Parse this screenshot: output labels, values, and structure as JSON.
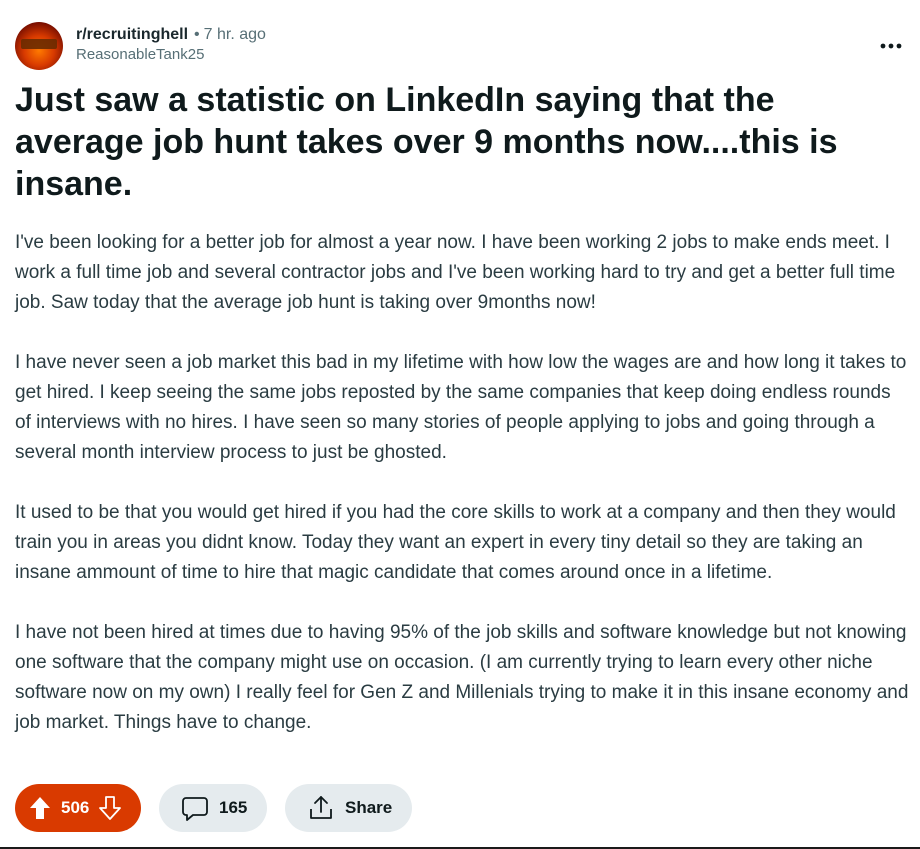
{
  "post": {
    "subreddit": "r/recruitinghell",
    "separator": "•",
    "time": "7 hr. ago",
    "author": "ReasonableTank25",
    "more_label": "•••",
    "title": "Just saw a statistic on LinkedIn saying that the average job hunt takes over 9 months now....this is insane.",
    "paragraphs": [
      "I've been looking for a better job for almost a year now. I have been working 2 jobs to make ends meet. I work a full time job and several contractor jobs and I've been working hard to try and get a better full time job. Saw today that the average job hunt is taking over 9months now!",
      "I have never seen a job market this bad in my lifetime with how low the wages are and how long it takes to get hired. I keep seeing the same jobs reposted by the same companies that keep doing endless rounds of interviews with no hires. I have seen so many stories of people applying to jobs and going through a several month interview process to just be ghosted.",
      "It used to be that you would get hired if you had the core skills to work at a company and then they would train you in areas you didnt know. Today they want an expert in every tiny detail so they are taking an insane ammount of time to hire that magic candidate that comes around once in a lifetime.",
      "I have not been hired at times due to having 95% of the job skills and software knowledge but not knowing one software that the company might use on occasion. (I am currently trying to learn every other niche software now on my own) I really feel for Gen Z and Millenials trying to make it in this insane economy and job market. Things have to change."
    ]
  },
  "actions": {
    "vote_count": "506",
    "comment_count": "165",
    "share_label": "Share"
  },
  "icons": {
    "more": "more-options-icon",
    "upvote": "upvote-arrow-icon",
    "downvote": "downvote-arrow-icon",
    "comment": "comment-bubble-icon",
    "share": "share-icon"
  },
  "colors": {
    "upvote_active_bg": "#d93a00",
    "pill_bg": "#e5ebee",
    "meta_text": "#576f76",
    "body_text": "#2a3c42"
  }
}
